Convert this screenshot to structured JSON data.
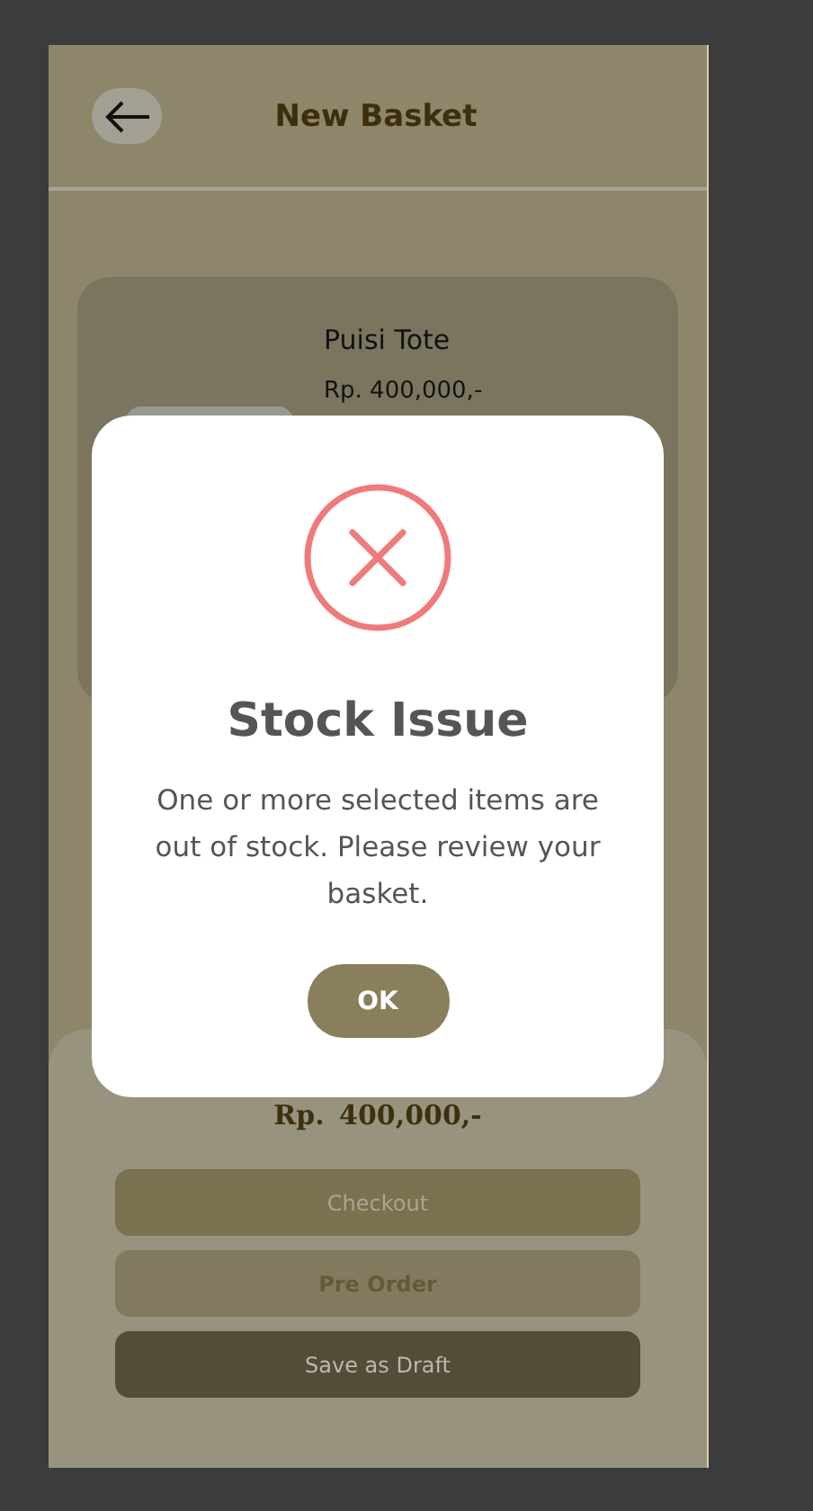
{
  "header": {
    "title": "New Basket"
  },
  "items": [
    {
      "name": "Puisi Tote",
      "price": "Rp. 400,000,-"
    }
  ],
  "summary": {
    "total": "Rp. 400,000,-"
  },
  "actions": [
    {
      "label": "Checkout",
      "kind": "primary"
    },
    {
      "label": "Pre Order",
      "kind": "secondary"
    },
    {
      "label": "Save as Draft",
      "kind": "dark"
    }
  ],
  "dialog": {
    "title": "Stock Issue",
    "message": "One or more selected items are out of stock. Please review your basket.",
    "button": "OK"
  }
}
